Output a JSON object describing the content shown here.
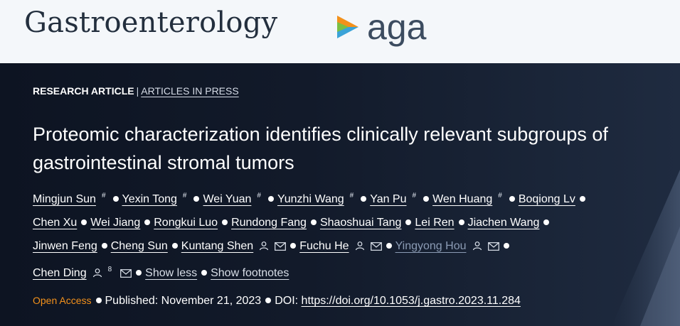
{
  "header": {
    "brand": "Gastroenterology",
    "partner_logo_text": "aga"
  },
  "breadcrumb": {
    "type": "RESEARCH ARTICLE",
    "separator": "|",
    "subtype": "ARTICLES IN PRESS"
  },
  "article": {
    "title": "Proteomic characterization identifies clinically relevant subgroups of gastrointestinal stromal tumors"
  },
  "authors": [
    {
      "name": "Mingjun Sun",
      "marker": "#"
    },
    {
      "name": "Yexin Tong",
      "marker": "#"
    },
    {
      "name": "Wei Yuan",
      "marker": "#"
    },
    {
      "name": "Yunzhi Wang",
      "marker": "#"
    },
    {
      "name": "Yan Pu",
      "marker": "#"
    },
    {
      "name": "Wen Huang",
      "marker": "#"
    },
    {
      "name": "Boqiong Lv"
    },
    {
      "name": "Chen Xu"
    },
    {
      "name": "Wei Jiang"
    },
    {
      "name": "Rongkui Luo"
    },
    {
      "name": "Rundong Fang"
    },
    {
      "name": "Shaoshuai Tang"
    },
    {
      "name": "Lei Ren"
    },
    {
      "name": "Jiachen Wang"
    },
    {
      "name": "Jinwen Feng"
    },
    {
      "name": "Cheng Sun"
    },
    {
      "name": "Kuntang Shen"
    },
    {
      "name": "Fuchu He"
    },
    {
      "name": "Yingyong Hou"
    },
    {
      "name": "Chen Ding",
      "marker": "8"
    }
  ],
  "author_links": {
    "show_less": "Show less",
    "show_footnotes": "Show footnotes"
  },
  "meta": {
    "open_access": "Open Access",
    "published": "Published: November 21, 2023",
    "doi_label": "DOI:",
    "doi_url": "https://doi.org/10.1053/j.gastro.2023.11.284"
  },
  "colors": {
    "header_bg": "#f4f7fa",
    "hero_bg": "#131c2c",
    "open_access": "#f3911b",
    "aga_logo_orange": "#f3911b",
    "aga_logo_blue": "#3aa3d8",
    "aga_logo_green": "#7bbf43"
  },
  "icons": [
    "person-icon",
    "mail-icon",
    "aga-play-logo-icon"
  ]
}
